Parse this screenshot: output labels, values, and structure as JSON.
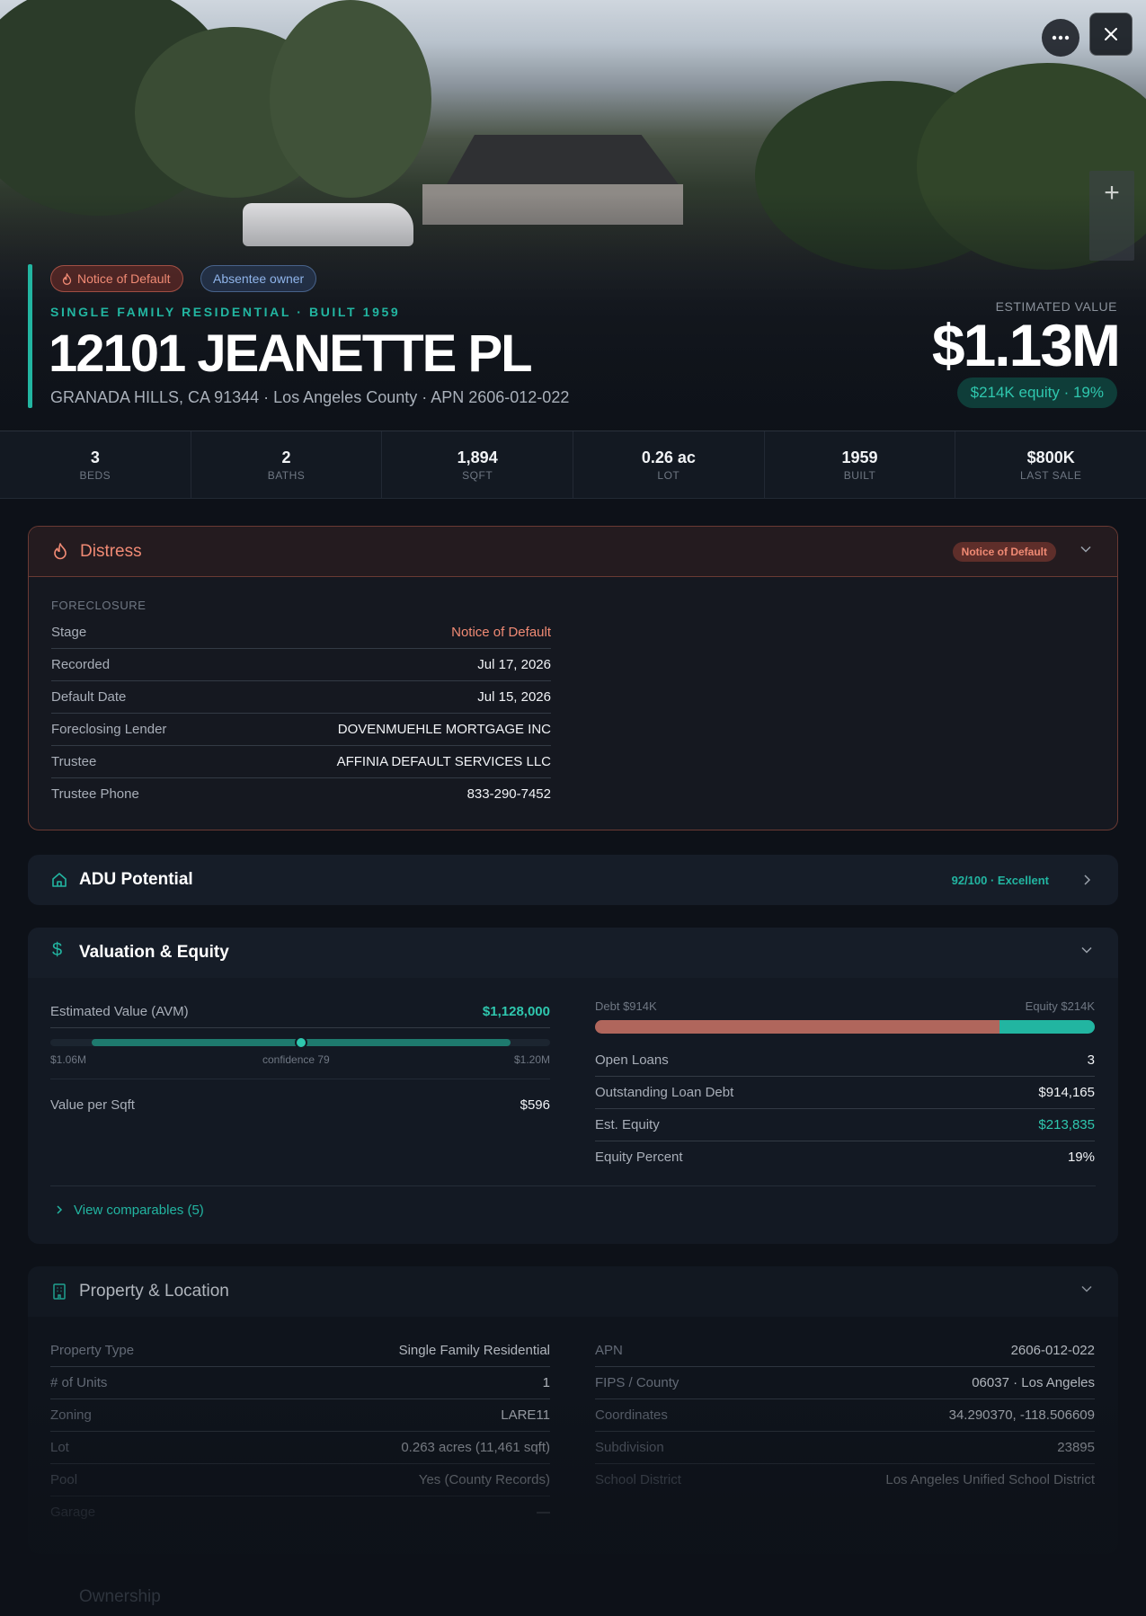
{
  "hero": {
    "badges": {
      "distress": "Notice of Default",
      "owner": "Absentee owner"
    },
    "property_type_line": "SINGLE FAMILY RESIDENTIAL · BUILT 1959",
    "address": "12101 JEANETTE PL",
    "subaddress": "GRANADA HILLS, CA 91344 · Los Angeles County · APN 2606-012-022",
    "estimated_value_label": "ESTIMATED VALUE",
    "estimated_value": "$1.13M",
    "equity_pill": "$214K equity · 19%"
  },
  "stats": [
    {
      "value": "3",
      "label": "BEDS"
    },
    {
      "value": "2",
      "label": "BATHS"
    },
    {
      "value": "1,894",
      "label": "SQFT"
    },
    {
      "value": "0.26 ac",
      "label": "LOT"
    },
    {
      "value": "1959",
      "label": "BUILT"
    },
    {
      "value": "$800K",
      "label": "LAST SALE"
    }
  ],
  "distress": {
    "title": "Distress",
    "badge": "Notice of Default",
    "section_label": "FORECLOSURE",
    "rows": [
      {
        "k": "Stage",
        "v": "Notice of Default"
      },
      {
        "k": "Recorded",
        "v": "Jul 17, 2026"
      },
      {
        "k": "Default Date",
        "v": "Jul 15, 2026"
      },
      {
        "k": "Foreclosing Lender",
        "v": "DOVENMUEHLE MORTGAGE INC"
      },
      {
        "k": "Trustee",
        "v": "AFFINIA DEFAULT SERVICES LLC"
      },
      {
        "k": "Trustee Phone",
        "v": "833-290-7452"
      }
    ]
  },
  "adu": {
    "title": "ADU Potential",
    "score": "92/100 · Excellent"
  },
  "valuation": {
    "title": "Valuation & Equity",
    "avm_label": "Estimated Value (AVM)",
    "avm_value": "$1,128,000",
    "range_low": "$1.06M",
    "confidence": "confidence 79",
    "range_high": "$1.20M",
    "value_per_sqft_label": "Value per Sqft",
    "value_per_sqft": "$596",
    "debt_label": "Debt $914K",
    "equity_label": "Equity $214K",
    "debt_share": 0.81,
    "equity_share": 0.19,
    "rows": [
      {
        "k": "Open Loans",
        "v": "3"
      },
      {
        "k": "Outstanding Loan Debt",
        "v": "$914,165"
      },
      {
        "k": "Est. Equity",
        "v": "$213,835"
      },
      {
        "k": "Equity Percent",
        "v": "19%"
      }
    ],
    "comparables": "View comparables (5)"
  },
  "property": {
    "title": "Property & Location",
    "left": [
      {
        "k": "Property Type",
        "v": "Single Family Residential"
      },
      {
        "k": "# of Units",
        "v": "1"
      },
      {
        "k": "Zoning",
        "v": "LARE11"
      },
      {
        "k": "Lot",
        "v": "0.263 acres (11,461 sqft)"
      },
      {
        "k": "Pool",
        "v": "Yes (County Records)"
      },
      {
        "k": "Garage",
        "v": "—"
      }
    ],
    "right": [
      {
        "k": "APN",
        "v": "2606-012-022"
      },
      {
        "k": "FIPS / County",
        "v": "06037 · Los Angeles"
      },
      {
        "k": "Coordinates",
        "v": "34.290370, -118.506609"
      },
      {
        "k": "Subdivision",
        "v": "23895"
      },
      {
        "k": "School District",
        "v": "Los Angeles Unified School District"
      }
    ]
  },
  "ownership": {
    "title": "Ownership"
  },
  "colors": {
    "accent": "#22b5a1",
    "distress": "#f08a74",
    "debt": "#b0665c"
  }
}
